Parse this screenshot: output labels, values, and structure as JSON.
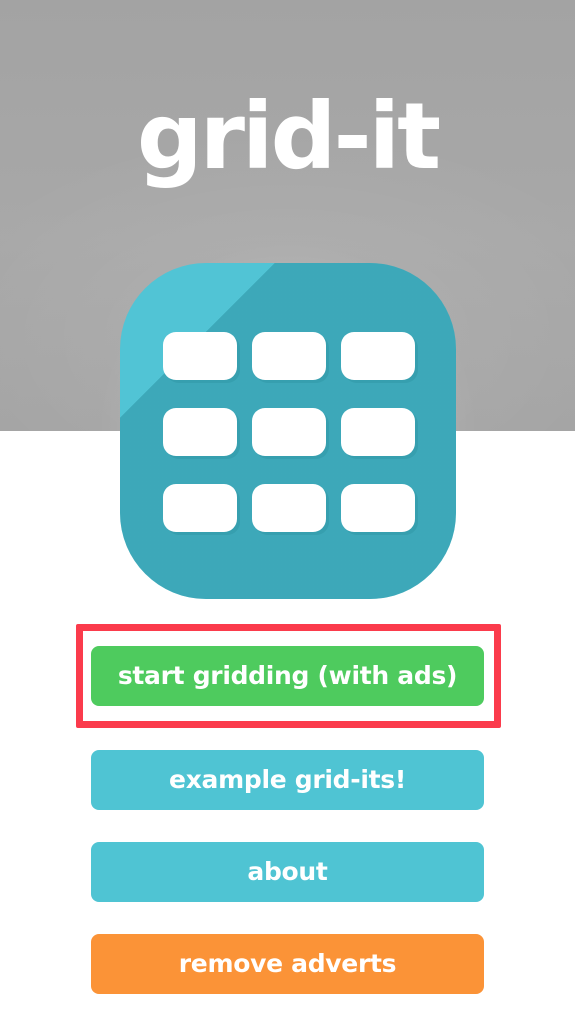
{
  "app": {
    "title": "grid-it"
  },
  "icon": {
    "name": "grid-it-app-icon",
    "cell_count": 9,
    "tile_color": "#51c4d5",
    "shadow_color": "#379dac",
    "cell_color": "#ffffff"
  },
  "background": {
    "band_color": "#a6a6a6",
    "page_color": "#ffffff"
  },
  "menu": {
    "buttons": [
      {
        "id": "start-gridding",
        "label": "start gridding (with ads)",
        "color": "#4ecb5e",
        "highlighted": true
      },
      {
        "id": "example-grid-its",
        "label": "example grid-its!",
        "color": "#4fc4d3",
        "highlighted": false
      },
      {
        "id": "about",
        "label": "about",
        "color": "#4fc4d3",
        "highlighted": false
      },
      {
        "id": "remove-adverts",
        "label": "remove adverts",
        "color": "#fb9337",
        "highlighted": false
      }
    ]
  },
  "highlight": {
    "color": "#fb3b4c",
    "target": "start gridding (with ads)"
  }
}
